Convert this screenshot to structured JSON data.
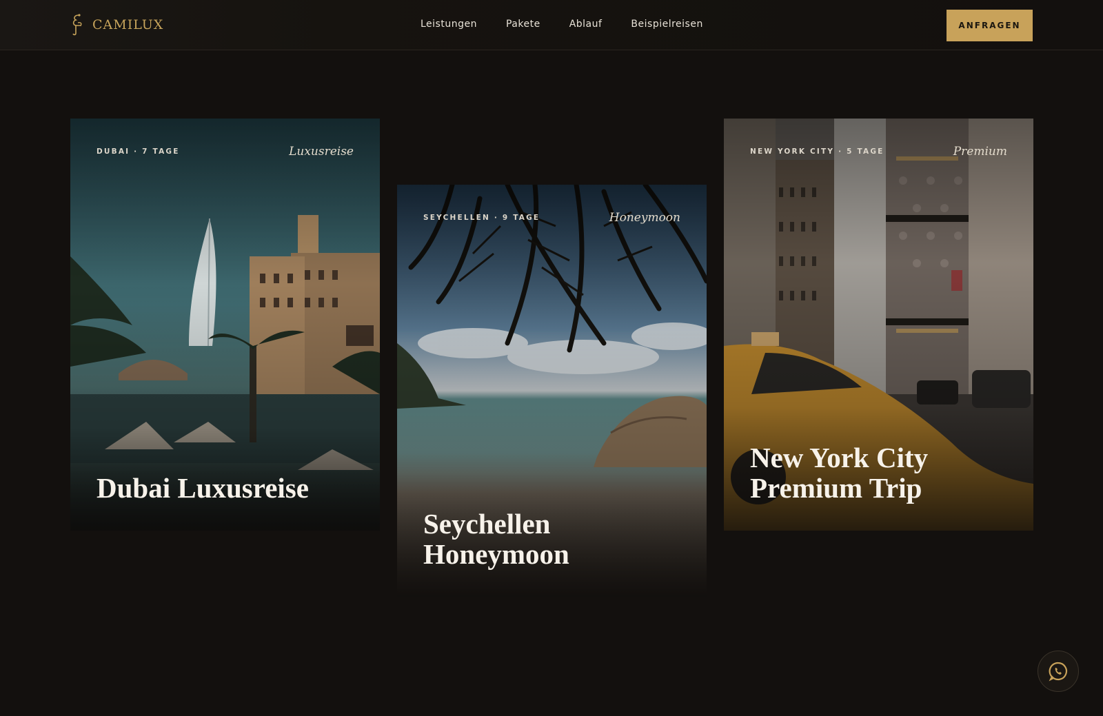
{
  "brand": {
    "name": "CAMILUX",
    "accent": "#c8a25a"
  },
  "nav": {
    "items": [
      "Leistungen",
      "Pakete",
      "Ablauf",
      "Beispielreisen"
    ]
  },
  "header": {
    "cta_label": "ANFRAGEN"
  },
  "cards": [
    {
      "meta": "DUBAI · 7 TAGE",
      "tag": "Luxusreise",
      "title": "Dubai Luxusreise"
    },
    {
      "meta": "SEYCHELLEN · 9 TAGE",
      "tag": "Honeymoon",
      "title": "Seychellen Honeymoon"
    },
    {
      "meta": "NEW YORK CITY · 5 TAGE",
      "tag": "Premium",
      "title": "New York City Premium Trip"
    }
  ],
  "floating": {
    "icon": "whatsapp-icon"
  }
}
